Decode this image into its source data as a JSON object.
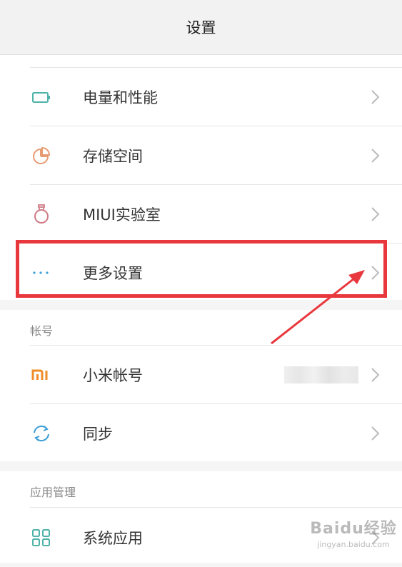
{
  "header": {
    "title": "设置"
  },
  "groups": {
    "system": {
      "items": [
        {
          "label": "电量和性能",
          "icon": "battery-icon",
          "color": "#4fb3a9"
        },
        {
          "label": "存储空间",
          "icon": "storage-pie-icon",
          "color": "#e79b72"
        },
        {
          "label": "MIUI实验室",
          "icon": "lab-flask-icon",
          "color": "#d07b86"
        },
        {
          "label": "更多设置",
          "icon": "more-dots-icon",
          "color": "#3b9ed6"
        }
      ]
    },
    "account": {
      "section_label": "帐号",
      "items": [
        {
          "label": "小米帐号",
          "icon": "mi-logo-icon",
          "color": "#f08c28"
        },
        {
          "label": "同步",
          "icon": "sync-icon",
          "color": "#3b9ed6"
        }
      ]
    },
    "apps": {
      "section_label": "应用管理",
      "items": [
        {
          "label": "系统应用",
          "icon": "apps-grid-icon",
          "color": "#4fb3a9"
        }
      ]
    }
  },
  "annotation": {
    "highlight_color": "#e8383d"
  },
  "watermark": {
    "main": "Baidu经验",
    "url": "jingyan.baidu.com"
  }
}
